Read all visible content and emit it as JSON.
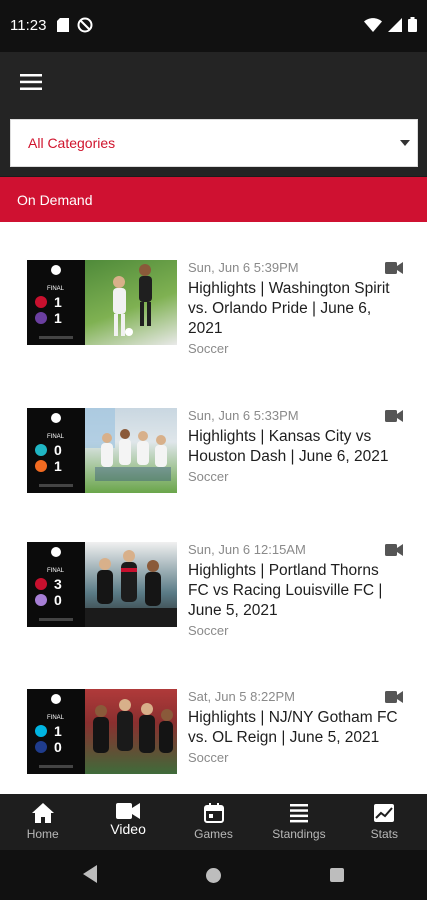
{
  "status_bar": {
    "time": "11:23"
  },
  "app_bar": {
    "menu_icon": "hamburger-menu-icon"
  },
  "filter": {
    "selected": "All Categories"
  },
  "section": {
    "title": "On Demand"
  },
  "videos": [
    {
      "date": "Sun, Jun 6 5:39PM",
      "title": "Highlights | Washington Spirit vs. Orlando Pride | June 6, 2021",
      "category": "Soccer",
      "score_home": "1",
      "score_away": "1",
      "status": "FINAL",
      "home_color": "#c8102e",
      "away_color": "#6b3fa0",
      "photo_colors": [
        "#4f8a3a",
        "#7fb152"
      ]
    },
    {
      "date": "Sun, Jun 6 5:33PM",
      "title": "Highlights | Kansas City vs Houston Dash | June 6, 2021",
      "category": "Soccer",
      "score_home": "0",
      "score_away": "1",
      "status": "FINAL",
      "home_color": "#1fb6c4",
      "away_color": "#f26b21",
      "photo_colors": [
        "#6aa54a",
        "#c9d7e1"
      ]
    },
    {
      "date": "Sun, Jun 6 12:15AM",
      "title": "Highlights | Portland Thorns FC vs Racing Louisville FC | June 5, 2021",
      "category": "Soccer",
      "score_home": "3",
      "score_away": "0",
      "status": "FINAL",
      "home_color": "#c8102e",
      "away_color": "#a77fd6",
      "photo_colors": [
        "#2b2b2b",
        "#5a7b86"
      ]
    },
    {
      "date": "Sat, Jun 5 8:22PM",
      "title": "Highlights | NJ/NY Gotham FC vs. OL Reign | June 5, 2021",
      "category": "Soccer",
      "score_home": "1",
      "score_away": "0",
      "status": "FINAL",
      "home_color": "#00b5e2",
      "away_color": "#1f3c8c",
      "photo_colors": [
        "#b03a3a",
        "#3f6b3a"
      ]
    }
  ],
  "bottom_nav": [
    {
      "label": "Home",
      "icon": "home-icon",
      "active": false
    },
    {
      "label": "Video",
      "icon": "video-camera-icon",
      "active": true
    },
    {
      "label": "Games",
      "icon": "calendar-icon",
      "active": false
    },
    {
      "label": "Standings",
      "icon": "list-icon",
      "active": false
    },
    {
      "label": "Stats",
      "icon": "chart-icon",
      "active": false
    }
  ],
  "colors": {
    "accent": "#cf1131",
    "app_bar": "#242424",
    "status_bar": "#111111"
  }
}
